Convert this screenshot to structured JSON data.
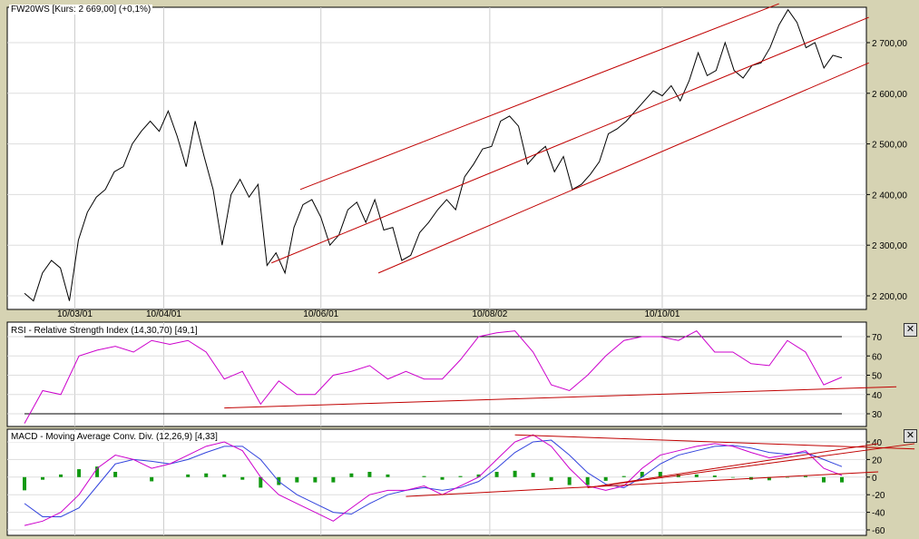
{
  "price_panel": {
    "title": "FW20WS [Kurs: 2 669,00] (+0,1%)",
    "y_ticks": [
      2200,
      2300,
      2400,
      2500,
      2600,
      2700
    ],
    "y_labels": [
      "2 200,00",
      "2 300,00",
      "2 400,00",
      "2 500,00",
      "2 600,00",
      "2 700,00"
    ],
    "ylim": [
      2200,
      2700
    ],
    "values": [
      2205,
      2190,
      2245,
      2270,
      2255,
      2190,
      2310,
      2365,
      2395,
      2410,
      2445,
      2455,
      2500,
      2525,
      2545,
      2525,
      2565,
      2515,
      2455,
      2545,
      2475,
      2410,
      2300,
      2400,
      2430,
      2395,
      2420,
      2260,
      2285,
      2245,
      2335,
      2380,
      2390,
      2355,
      2300,
      2320,
      2370,
      2385,
      2345,
      2390,
      2330,
      2335,
      2270,
      2280,
      2325,
      2345,
      2370,
      2390,
      2370,
      2435,
      2460,
      2490,
      2495,
      2545,
      2555,
      2535,
      2460,
      2480,
      2495,
      2445,
      2475,
      2410,
      2420,
      2440,
      2465,
      2520,
      2530,
      2545,
      2565,
      2585,
      2605,
      2595,
      2615,
      2585,
      2625,
      2680,
      2635,
      2645,
      2700,
      2645,
      2630,
      2655,
      2660,
      2690,
      2735,
      2765,
      2740,
      2690,
      2700,
      2650,
      2675,
      2670
    ],
    "trendlines": [
      {
        "from": [
          30.7,
          2410
        ],
        "to": [
          84,
          2777
        ]
      },
      {
        "from": [
          27.5,
          2265
        ],
        "to": [
          94,
          2750
        ]
      },
      {
        "from": [
          39.4,
          2245
        ],
        "to": [
          94,
          2660
        ]
      }
    ]
  },
  "x_labels": [
    {
      "label": "10/03/01",
      "idx": 5.6
    },
    {
      "label": "10/04/01",
      "idx": 15.5
    },
    {
      "label": "10/06/01",
      "idx": 33
    },
    {
      "label": "10/08/02",
      "idx": 51.8
    },
    {
      "label": "10/10/01",
      "idx": 71
    }
  ],
  "rsi_panel": {
    "title": "RSI - Relative Strength Index (14,30,70) [49,1]",
    "y_ticks": [
      30,
      40,
      50,
      60,
      70
    ],
    "levels": [
      30,
      70
    ],
    "values": [
      25,
      42,
      40,
      60,
      63,
      65,
      62,
      68,
      66,
      68,
      62,
      48,
      52,
      35,
      47,
      40,
      40,
      50,
      52,
      55,
      48,
      52,
      48,
      48,
      58,
      70,
      72,
      73,
      62,
      45,
      42,
      50,
      60,
      68,
      70,
      70,
      68,
      73,
      62,
      62,
      56,
      55,
      68,
      62,
      45,
      49
    ],
    "trendline": {
      "from": [
        11,
        33
      ],
      "to": [
        48,
        44
      ]
    }
  },
  "macd_panel": {
    "title": "MACD - Moving Average Conv. Div. (12,26,9) [4,33]",
    "y_ticks": [
      -60,
      -40,
      -20,
      0,
      20,
      40
    ],
    "macd": [
      -55,
      -50,
      -40,
      -20,
      10,
      25,
      20,
      10,
      15,
      25,
      35,
      40,
      30,
      0,
      -20,
      -30,
      -40,
      -50,
      -35,
      -20,
      -15,
      -15,
      -10,
      -20,
      -10,
      0,
      20,
      40,
      48,
      35,
      10,
      -10,
      -15,
      -10,
      10,
      25,
      30,
      35,
      38,
      35,
      28,
      22,
      25,
      30,
      10,
      2
    ],
    "signal": [
      -30,
      -45,
      -45,
      -35,
      -10,
      15,
      20,
      18,
      15,
      20,
      28,
      35,
      35,
      20,
      -5,
      -20,
      -30,
      -40,
      -42,
      -30,
      -20,
      -15,
      -12,
      -15,
      -12,
      -5,
      10,
      28,
      40,
      42,
      25,
      5,
      -8,
      -12,
      0,
      15,
      25,
      30,
      35,
      36,
      33,
      28,
      26,
      28,
      20,
      12
    ],
    "trendlines": [
      {
        "from": [
          21,
          -22
        ],
        "to": [
          47,
          6
        ]
      },
      {
        "from": [
          27,
          48
        ],
        "to": [
          49,
          32
        ]
      },
      {
        "from": [
          31,
          -12
        ],
        "to": [
          49,
          38
        ]
      },
      {
        "from": [
          31,
          -12
        ],
        "to": [
          47,
          38
        ]
      }
    ]
  },
  "colors": {
    "price": "#000000",
    "trend": "#c00000",
    "rsi": "#cc00cc",
    "macd": "#cc00cc",
    "signal": "#3344dd",
    "hist": "#119911"
  }
}
